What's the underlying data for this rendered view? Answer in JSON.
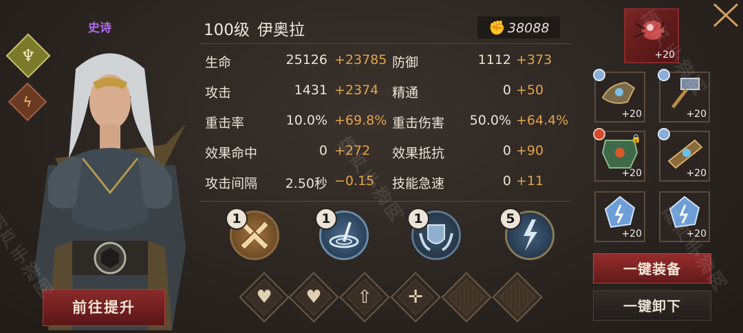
{
  "hero": {
    "rarity": "史诗",
    "level": "100级",
    "name": "伊奥拉",
    "power": "38088"
  },
  "stats_left": [
    {
      "label": "生命",
      "base": "25126",
      "bonus": "+23785"
    },
    {
      "label": "攻击",
      "base": "1431",
      "bonus": "+2374"
    },
    {
      "label": "重击率",
      "base": "10.0%",
      "bonus": "+69.8%"
    },
    {
      "label": "效果命中",
      "base": "0",
      "bonus": "+272"
    },
    {
      "label": "攻击间隔",
      "base": "2.50秒",
      "bonus": "−0.15"
    }
  ],
  "stats_right": [
    {
      "label": "防御",
      "base": "1112",
      "bonus": "+373"
    },
    {
      "label": "精通",
      "base": "0",
      "bonus": "+50"
    },
    {
      "label": "重击伤害",
      "base": "50.0%",
      "bonus": "+64.4%"
    },
    {
      "label": "效果抵抗",
      "base": "0",
      "bonus": "+90"
    },
    {
      "label": "技能急速",
      "base": "0",
      "bonus": "+11"
    }
  ],
  "skills": [
    {
      "level": "1",
      "icon": "crossed-swords-icon"
    },
    {
      "level": "1",
      "icon": "whirlwind-icon"
    },
    {
      "level": "1",
      "icon": "shield-hands-icon"
    },
    {
      "level": "5",
      "icon": "lightning-icon"
    }
  ],
  "runes": [
    {
      "icon": "heart-icon",
      "glyph": "♥"
    },
    {
      "icon": "heart-hands-icon",
      "glyph": "♥"
    },
    {
      "icon": "arrow-up-icon",
      "glyph": "⇧"
    },
    {
      "icon": "crosshair-icon",
      "glyph": "✛"
    },
    {
      "icon": "empty-slot-icon",
      "glyph": ""
    },
    {
      "icon": "empty-slot-icon",
      "glyph": ""
    }
  ],
  "equipment": [
    {
      "slot": "artifact",
      "level": "+20"
    },
    {
      "slot": "weapon",
      "level": "+20"
    },
    {
      "slot": "hammer",
      "level": "+20"
    },
    {
      "slot": "armor",
      "level": "+20"
    },
    {
      "slot": "bracer",
      "level": "+20"
    },
    {
      "slot": "crystal-1",
      "level": "+20"
    },
    {
      "slot": "crystal-2",
      "level": "+20"
    }
  ],
  "buttons": {
    "upgrade": "前往提升",
    "equip_all": "一键装备",
    "unequip_all": "一键卸下"
  },
  "colors": {
    "bonus": "#e5a44a",
    "rarity": "#b06cf0",
    "accent_red": "#962c2c"
  },
  "watermark": "葫芦手游网"
}
